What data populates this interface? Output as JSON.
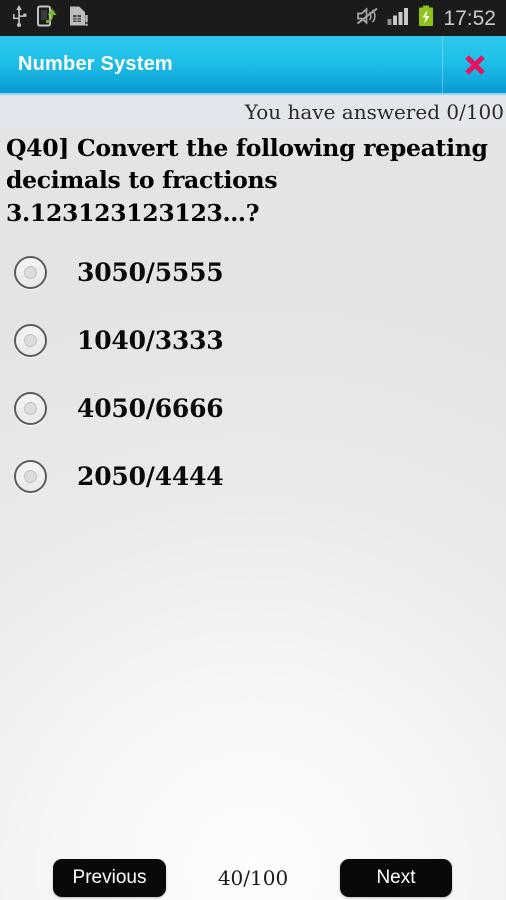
{
  "statusbar": {
    "icons_left": [
      "usb-icon",
      "phone-transfer-icon",
      "sim-card-alert-icon"
    ],
    "icons_right": [
      "sound-mute-icon",
      "signal-bars-icon",
      "battery-charging-icon"
    ],
    "clock": "17:52",
    "battery_color": "#8ec417",
    "signal_color": "#c9c9c9"
  },
  "titlebar": {
    "title": "Number System",
    "close_icon": "close-x-icon",
    "accent_color": "#1ec0e8",
    "close_color": "#e8125e"
  },
  "answered": {
    "text": "You have answered 0/100",
    "count": 0,
    "total": 100
  },
  "question": {
    "number": "Q40]",
    "text": "Q40]  Convert the following repeating decimals to fractions 3.123123123123…?"
  },
  "options": [
    {
      "label": "3050/5555",
      "selected": false
    },
    {
      "label": "1040/3333",
      "selected": false
    },
    {
      "label": "4050/6666",
      "selected": false
    },
    {
      "label": "2050/4444",
      "selected": false
    }
  ],
  "footer": {
    "previous_label": "Previous",
    "next_label": "Next",
    "progress": "40/100",
    "current_index": 40,
    "total": 100
  }
}
